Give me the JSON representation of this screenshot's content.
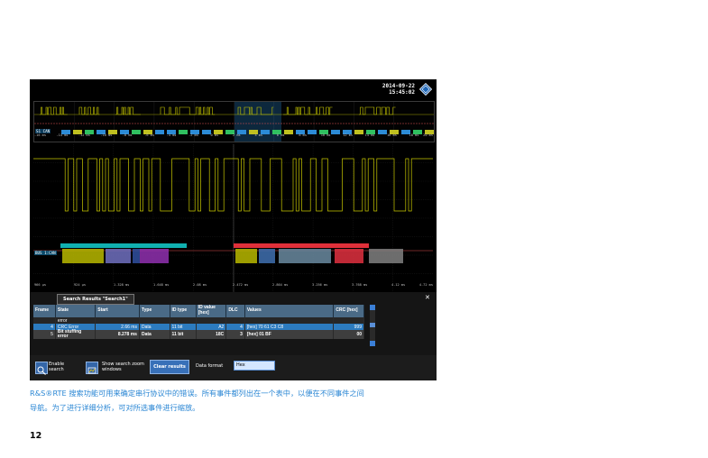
{
  "scope": {
    "date": "2014-09-22",
    "time": "15:45:02",
    "zoom_bus_label": "S1 CAN",
    "main_bus_label": "BUS 1:CAN",
    "zoom_scale": [
      "-16 ms",
      "-14 ms",
      "-12 ms",
      "-10 ms",
      "-8 ms",
      "-6 ms",
      "-4 ms",
      "-2 ms",
      "0 ms",
      "2 ms",
      "4 ms",
      "6 ms",
      "8 ms",
      "10 ms",
      "12 ms",
      "14 ms",
      "16 ms",
      "18 ms",
      "20 ms"
    ],
    "main_scale": [
      "966 µs",
      "924 µs",
      "1.328 ms",
      "1.648 ms",
      "2.08 ms",
      "2.472 ms",
      "2.864 ms",
      "3.256 ms",
      "3.768 ms",
      "4.12 ms",
      "4.72 ms"
    ],
    "colors": {
      "trace": "#c8c800",
      "zoom_region": "#2c8bd6",
      "frame_ok": "#10b0b0",
      "frame_error": "#e0303a"
    }
  },
  "search": {
    "tab_label": "Search Results \"Search1\"",
    "columns": [
      "Frame",
      "State",
      "Start",
      "Type",
      "ID type",
      "ID value [hex]",
      "DLC",
      "Values",
      "CRC [hex]"
    ],
    "partial_top": "error",
    "rows": [
      {
        "frame": "4",
        "state": "CRC Error",
        "start": "2.66 ms",
        "type": "Data",
        "id_type": "11 bit",
        "id_value": "A2",
        "dlc": "4",
        "values": "[hex] 70 61 C3 C8",
        "crc": "999"
      },
      {
        "frame": "5",
        "state": "Bit stuffing error",
        "start": "8.278 ms",
        "type": "Data",
        "id_type": "11 bit",
        "id_value": "18C",
        "dlc": "3",
        "values": "[hex] 01 BF",
        "crc": "00"
      }
    ],
    "enable_search_label": "Enable search",
    "show_zoom_label": "Show search zoom windows",
    "clear_results_label": "Clear results",
    "data_format_label": "Data format",
    "data_format_value": "Hex"
  },
  "caption": {
    "line1": "R&S®RTE 搜索功能可用来确定串行协议中的错误。所有事件都列出在一个表中，以便在不同事件之间",
    "line2": "导航。为了进行详细分析，可对所选事件进行缩放。"
  },
  "page_number": "12"
}
